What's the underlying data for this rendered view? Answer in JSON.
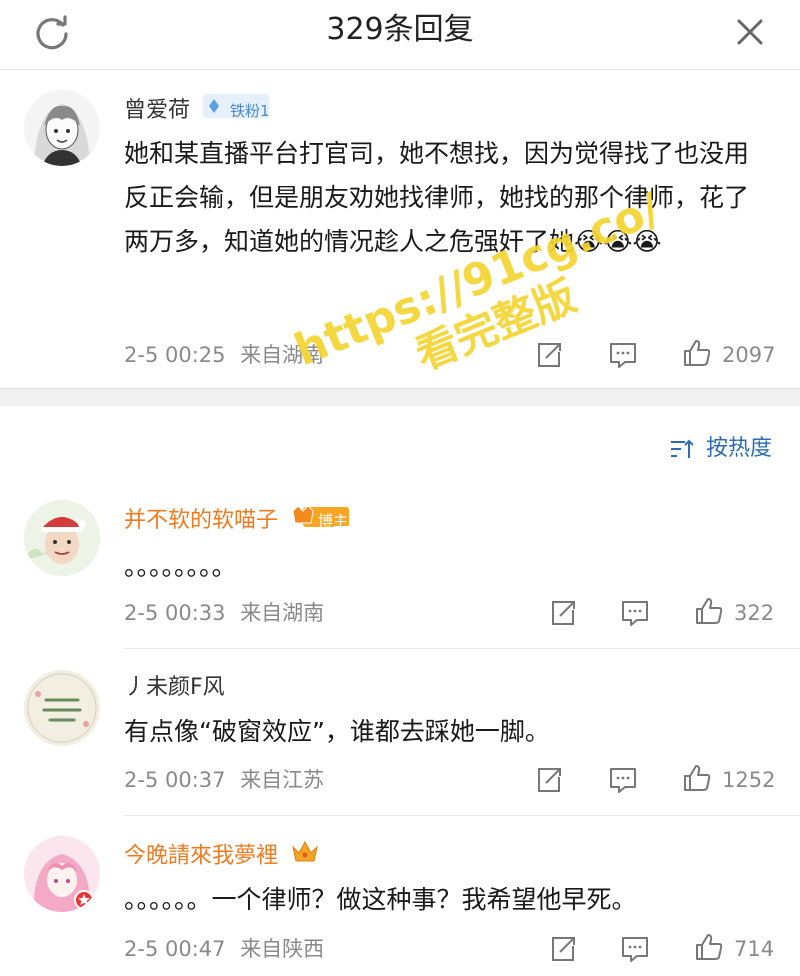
{
  "header": {
    "title": "329条回复",
    "refresh_icon": "refresh-icon",
    "close_icon": "close-icon"
  },
  "main_comment": {
    "username": "曾爱荷",
    "badge": "铁粉1",
    "text": "她和某直播平台打官司，她不想找，因为觉得找了也没用反正会输，但是朋友劝她找律师，她找的那个律师，花了两万多，知道她的情况趁人之危强奸了她😭😭😭",
    "time": "2-5 00:25",
    "location": "来自湖南",
    "likes": "2097"
  },
  "sort": {
    "label": "按热度",
    "icon": "sort-icon"
  },
  "replies": [
    {
      "username": "并不软的软喵子",
      "badge": "博主",
      "name_color": "#f07b1e",
      "text": "。。。。。。。。",
      "time": "2-5 00:33",
      "location": "来自湖南",
      "likes": "322"
    },
    {
      "username": "丿未颜F风",
      "badge": "",
      "name_color": "#333333",
      "text": "有点像“破窗效应”，谁都去踩她一脚。",
      "time": "2-5 00:37",
      "location": "来自江苏",
      "likes": "1252"
    },
    {
      "username": "今晚請來我夢裡",
      "badge": "crown",
      "name_color": "#f07b1e",
      "text": "。。。。。。一个律师？做这种事？我希望他早死。",
      "time": "2-5 00:47",
      "location": "来自陕西",
      "likes": "714"
    }
  ],
  "watermark": {
    "line1": "https://91cg.co/",
    "line2": "看完整版"
  },
  "colors": {
    "accent_orange": "#f07b1e",
    "link_blue": "#2a6db5",
    "meta_gray": "#8a8a8a",
    "watermark_yellow": "#f5d531"
  }
}
